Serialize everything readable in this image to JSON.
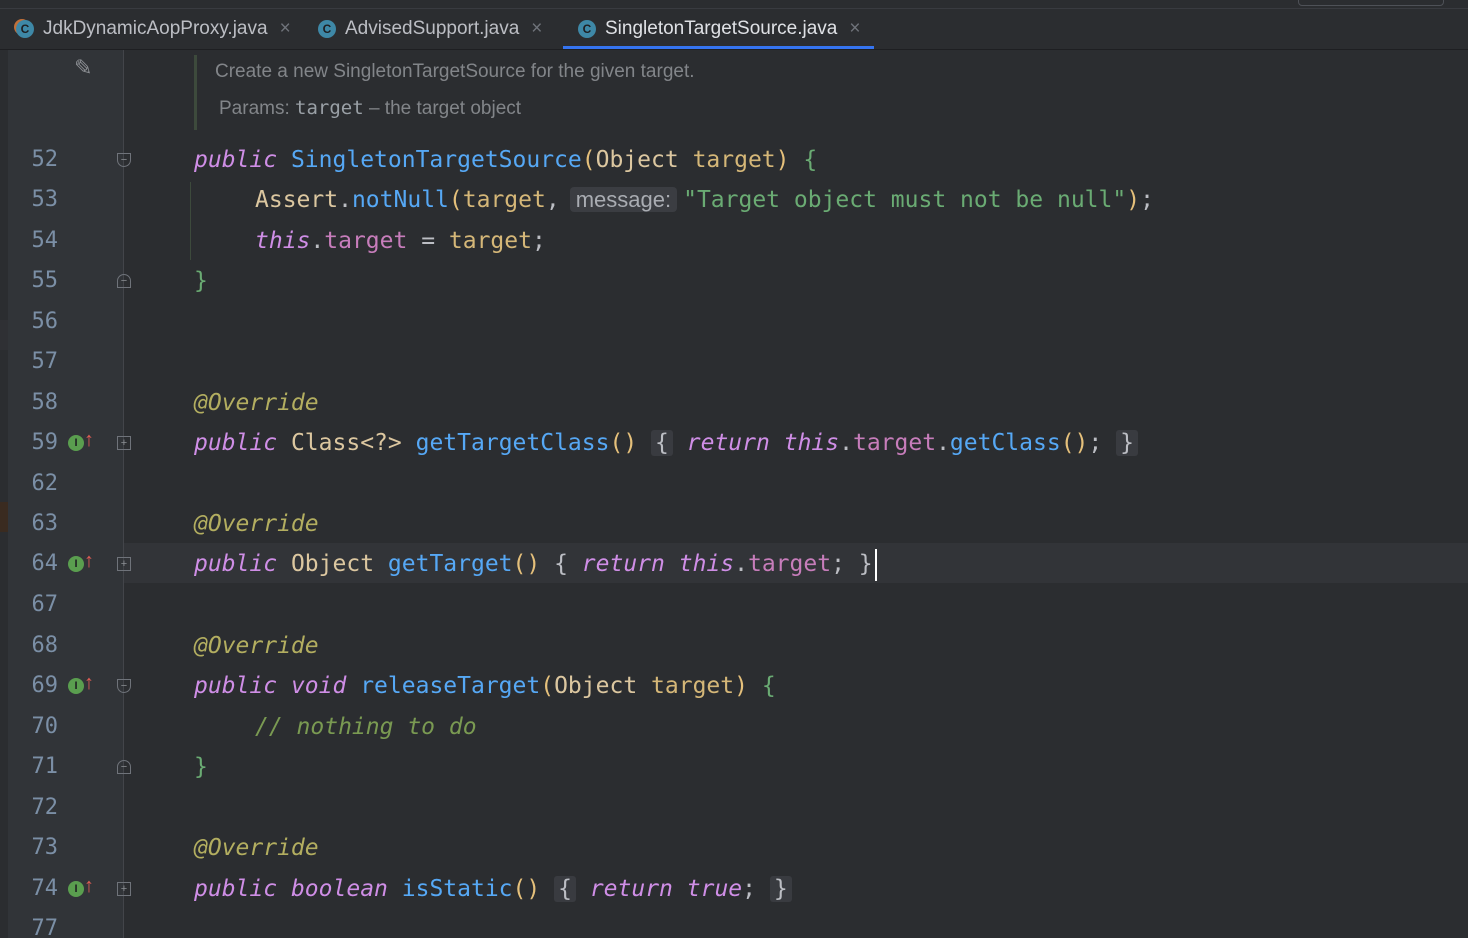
{
  "tabs": [
    {
      "label": "JdkDynamicAopProxy.java",
      "icon": "class-icon",
      "active": false
    },
    {
      "label": "AdvisedSupport.java",
      "icon": "class-icon",
      "active": false
    },
    {
      "label": "SingletonTargetSource.java",
      "icon": "class-icon",
      "active": true
    }
  ],
  "close_glyph": "×",
  "doc": {
    "line1": "Create a new SingletonTargetSource for the given target.",
    "params_label": "Params:",
    "params_code": "target",
    "params_desc": " – the target object"
  },
  "hint": {
    "message": "message:"
  },
  "string_literal": "\"Target object must not be null\"",
  "comment_text": "// nothing to do",
  "line_numbers": [
    "52",
    "53",
    "54",
    "55",
    "56",
    "57",
    "58",
    "59",
    "62",
    "63",
    "64",
    "67",
    "68",
    "69",
    "70",
    "71",
    "72",
    "73",
    "74",
    "77"
  ],
  "tokens": {
    "public": "public",
    "void": "void",
    "boolean": "boolean",
    "return": "return",
    "this": "this",
    "true": "true",
    "override": "@Override",
    "ctor": "SingletonTargetSource",
    "Object": "Object",
    "target": "target",
    "Assert": "Assert",
    "notNull": "notNull",
    "Class": "Class",
    "generic": "<?>",
    "getTargetClass": "getTargetClass",
    "getClass": "getClass",
    "getTarget": "getTarget",
    "releaseTarget": "releaseTarget",
    "isStatic": "isStatic"
  },
  "colors": {
    "accent": "#3574f0",
    "background": "#2b2d30",
    "keyword": "#cf8ee6",
    "function": "#56a8f5",
    "string": "#6aab73"
  }
}
